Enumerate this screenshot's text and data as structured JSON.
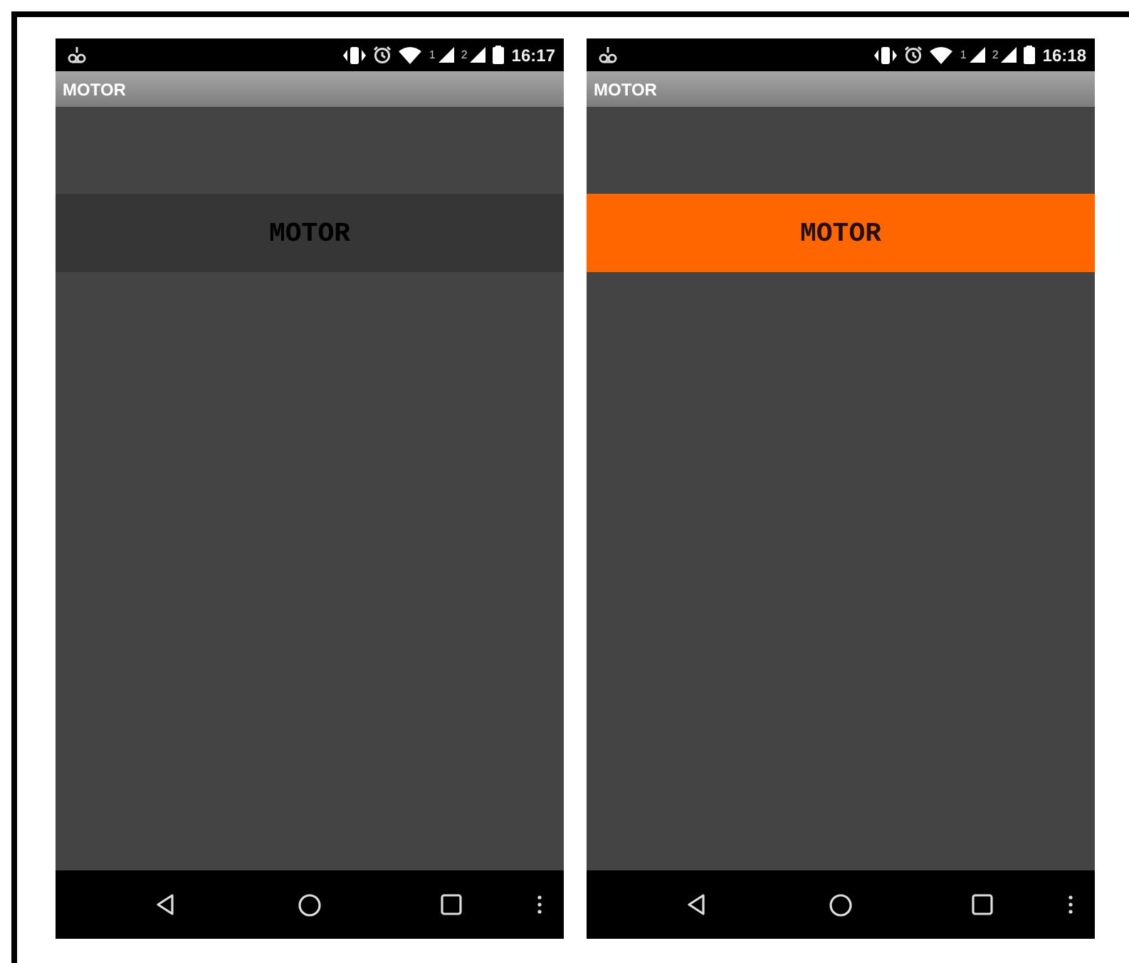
{
  "phones": [
    {
      "status_bar": {
        "signals": [
          {
            "label": "1"
          },
          {
            "label": "2"
          }
        ],
        "time": "16:17"
      },
      "app_title": "MOTOR",
      "button": {
        "label": "MOTOR",
        "on": false
      }
    },
    {
      "status_bar": {
        "signals": [
          {
            "label": "1"
          },
          {
            "label": "2"
          }
        ],
        "time": "16:18"
      },
      "app_title": "MOTOR",
      "button": {
        "label": "MOTOR",
        "on": true
      }
    }
  ]
}
